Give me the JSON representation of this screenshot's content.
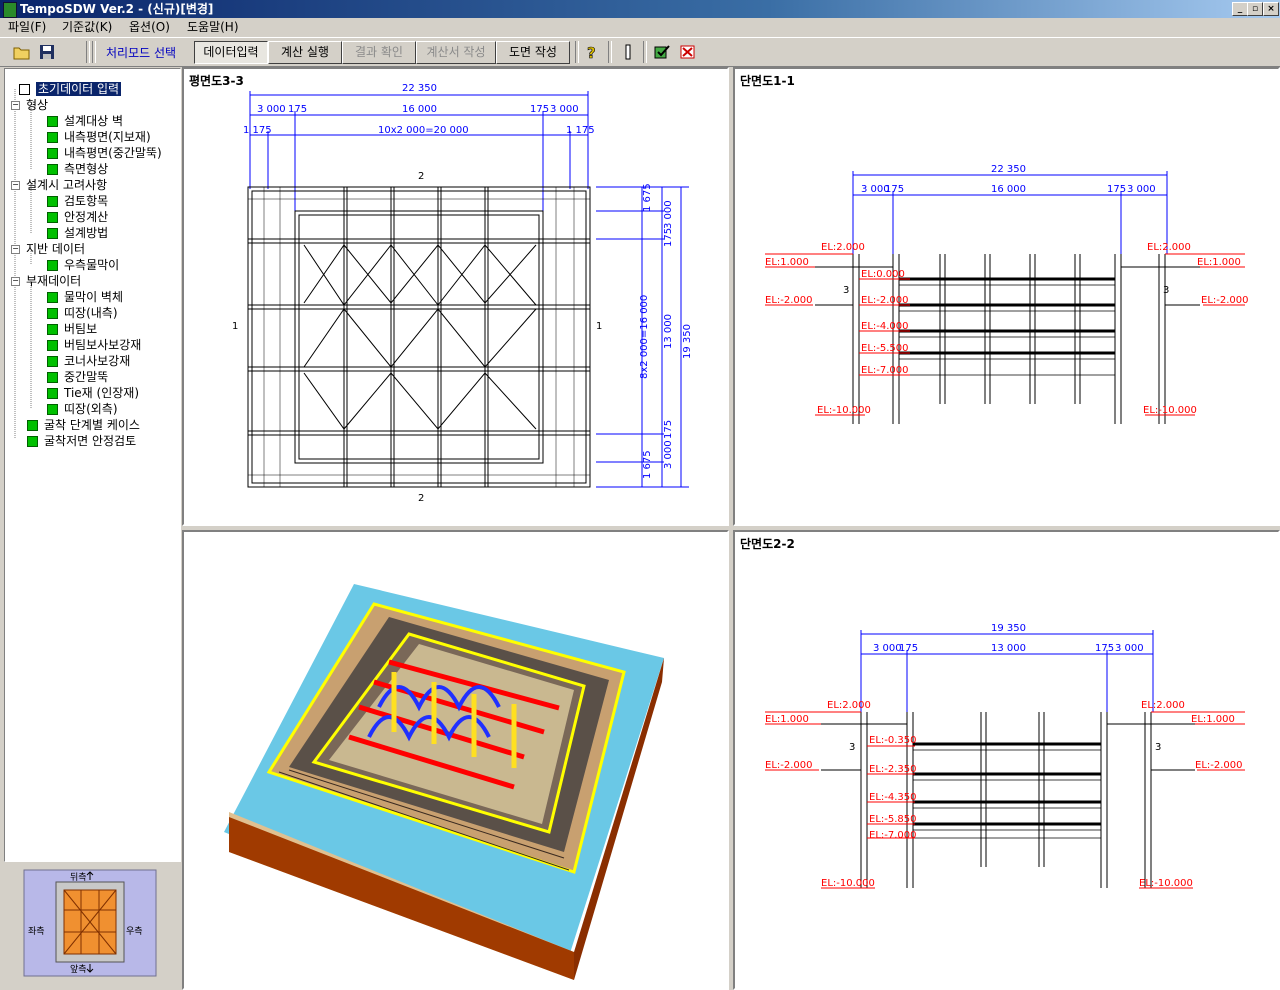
{
  "window": {
    "title": "TempoSDW Ver.2 - (신규)[변경]"
  },
  "menu": [
    "파일(F)",
    "기준값(K)",
    "옵션(O)",
    "도움말(H)"
  ],
  "toolbar": {
    "mode_label": "처리모드 선택",
    "tabs": [
      "데이터입력",
      "계산 실행",
      "결과 확인",
      "계산서 작성",
      "도면 작성"
    ]
  },
  "tree": [
    {
      "label": "초기데이터 입력"
    },
    {
      "label": "형상"
    },
    {
      "label": "설계대상 벽"
    },
    {
      "label": "내측평면(지보재)"
    },
    {
      "label": "내측평면(중간말뚝)"
    },
    {
      "label": "측면형상"
    },
    {
      "label": "설계시 고려사항"
    },
    {
      "label": "검토항목"
    },
    {
      "label": "안정계산"
    },
    {
      "label": "설계방법"
    },
    {
      "label": "지반 데이터"
    },
    {
      "label": "우측물막이"
    },
    {
      "label": "부재데이터"
    },
    {
      "label": "물막이 벽체"
    },
    {
      "label": "띠장(내측)"
    },
    {
      "label": "버팀보"
    },
    {
      "label": "버팀보사보강재"
    },
    {
      "label": "코너사보강재"
    },
    {
      "label": "중간말뚝"
    },
    {
      "label": "Tie재 (인장재)"
    },
    {
      "label": "띠장(외측)"
    },
    {
      "label": "굴착 단계별 케이스"
    },
    {
      "label": "굴착저면 안정검토"
    }
  ],
  "navigator": {
    "top": "뒤측",
    "bottom": "앞측",
    "left": "좌측",
    "right": "우측"
  },
  "plan": {
    "title": "평면도3-3",
    "dims": {
      "total": "22 350",
      "d1": "3 000",
      "d2": "175",
      "d3": "16 000",
      "d4": "175",
      "d5": "3 000",
      "e1": "1 175",
      "e2": "10x2 000=20 000",
      "e3": "1 175",
      "v_total": "19 350",
      "v_mid": "13 000",
      "v_in": "8x2 000=16 000",
      "v1": "1 675",
      "v2": "3 000",
      "v3": "175",
      "v4": "175",
      "v5": "3 000",
      "v6": "1 675",
      "sec1": "1",
      "sec2": "2"
    }
  },
  "section1": {
    "title": "단면도1-1",
    "total": "22 350",
    "d1": "3 000",
    "d2": "175",
    "d3": "16 000",
    "d4": "175",
    "d5": "3 000",
    "el_top": "EL:2.000",
    "el_gl": "EL:1.000",
    "el_w": "EL:-2.000",
    "el_bot": "EL:-10.000",
    "levels": [
      "EL:0.000",
      "EL:-2.000",
      "EL:-4.000",
      "EL:-5.500",
      "EL:-7.000"
    ],
    "wl": "3"
  },
  "section2": {
    "title": "단면도2-2",
    "total": "19 350",
    "d1": "3 000",
    "d2": "175",
    "d3": "13 000",
    "d4": "175",
    "d5": "3 000",
    "el_top": "EL:2.000",
    "el_gl": "EL:1.000",
    "el_w": "EL:-2.000",
    "el_bot": "EL:-10.000",
    "levels": [
      "EL:-0.350",
      "EL:-2.350",
      "EL:-4.350",
      "EL:-5.850",
      "EL:-7.000"
    ],
    "wl": "3"
  },
  "colors": {
    "dim": "#0000ff",
    "el": "#ff0000",
    "struct": "#000000",
    "title_bg": "#0a246a"
  }
}
